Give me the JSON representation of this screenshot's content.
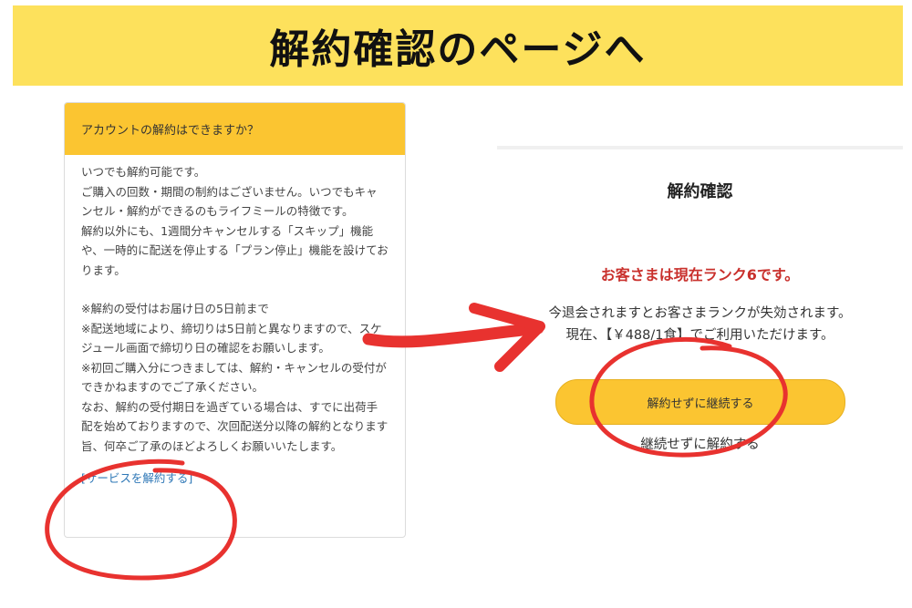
{
  "banner": {
    "title": "解約確認のページへ"
  },
  "faq": {
    "question": "アカウントの解約はできますか？",
    "paragraph1": "いつでも解約可能です。\nご購入の回数・期間の制約はございません。いつでもキャンセル・解約ができるのもライフミールの特徴です。\n解約以外にも、1週間分キャンセルする「スキップ」機能や、一時的に配送を停止する「プラン停止」機能を設けております。",
    "paragraph2": "※解約の受付はお届け日の5日前まで\n※配送地域により、締切りは5日前と異なりますので、スケジュール画面で締切り日の確認をお願いします。\n※初回ご購入分につきましては、解約・キャンセルの受付ができかねますのでご了承ください。\nなお、解約の受付期日を過ぎている場合は、すでに出荷手配を始めておりますので、次回配送分以降の解約となります旨、何卒ご了承のほどよろしくお願いいたします。",
    "cancel_service_link": "[サービスを解約する]"
  },
  "confirm": {
    "title": "解約確認",
    "rank_message": "お客さまは現在ランク6です。",
    "expire_line1": "今退会されますとお客さまランクが失効されます。",
    "expire_line2": "現在、【￥488/1食】でご利用いただけます。",
    "continue_button": "解約せずに継続する",
    "cancel_link": "継続せずに解約する"
  },
  "colors": {
    "banner": "#fde15c",
    "accent": "#fbc531",
    "highlight_red": "#e8322f",
    "rank_red": "#c9302c",
    "link_blue": "#2f78b7"
  }
}
